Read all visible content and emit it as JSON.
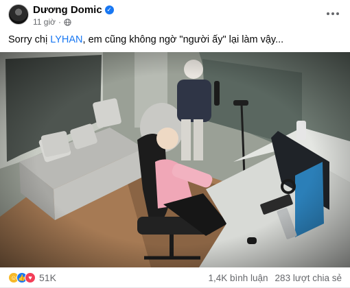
{
  "post": {
    "author": "Dương Domic",
    "time": "11 giờ",
    "caption_before": "Sorry chị ",
    "mention": "LYHAN",
    "caption_after": ", em cũng không ngờ \"người ấy\" lại làm vậy..."
  },
  "icons": {
    "verified": "verified-badge-icon",
    "privacy": "globe-icon",
    "more": "more-options-icon",
    "reactions": [
      "haha-reaction-icon",
      "like-reaction-icon",
      "love-reaction-icon"
    ]
  },
  "engagement": {
    "reaction_count": "51K",
    "comments": "1,4K bình luận",
    "shares": "283 lượt chia sẻ"
  },
  "colors": {
    "accent": "#1877f2",
    "secondary_text": "#65676b",
    "haha": "#f7b928",
    "love": "#f33e58"
  }
}
